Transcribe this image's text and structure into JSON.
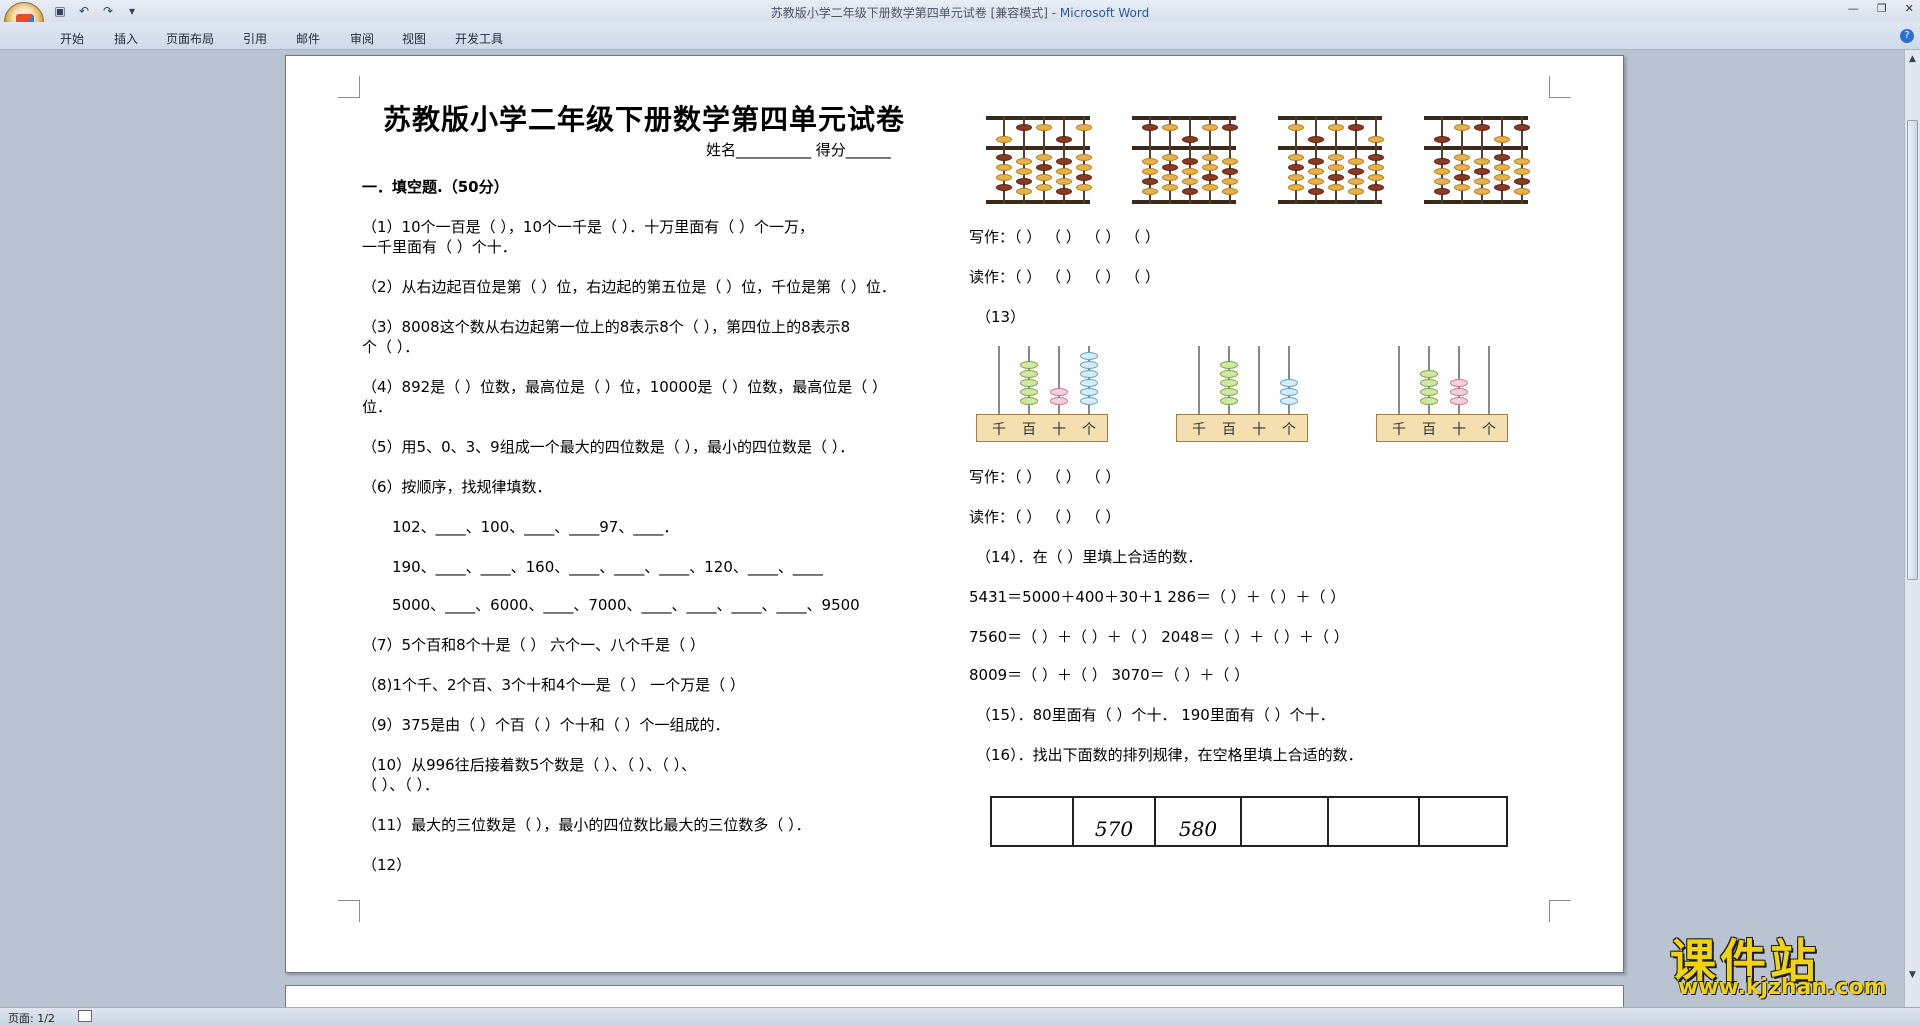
{
  "window": {
    "title_doc": "苏教版小学二年级下册数学第四单元试卷 [兼容模式] - ",
    "title_app": "Microsoft Word"
  },
  "menu": [
    "开始",
    "插入",
    "页面布局",
    "引用",
    "邮件",
    "审阅",
    "视图",
    "开发工具"
  ],
  "status": {
    "page": "页面: 1/2"
  },
  "doc": {
    "title": "苏教版小学二年级下册数学第四单元试卷",
    "name_line": "姓名__________   得分______",
    "section1": "一．填空题.（50分）",
    "q1a": "（1）10个一百是（    ），10个一千是（    ）．十万里面有（    ）个一万，",
    "q1b": "一千里面有（    ）个十．",
    "q2": "（2）从右边起百位是第（  ）位，右边起的第五位是（  ）位，千位是第（  ）位．",
    "q3a": "（3）8008这个数从右边起第一位上的8表示8个（    ），第四位上的8表示8",
    "q3b": "个（    ）．",
    "q4a": "（4）892是（  ）位数，最高位是（  ）位，10000是（  ）位数，最高位是（  ）",
    "q4b": "位．",
    "q5": "（5）用5、0、3、9组成一个最大的四位数是（    ），最小的四位数是（    ）．",
    "q6": "（6）按顺序，找规律填数．",
    "q6a": "102、____、100、____、____97、____．",
    "q6b": "190、____、____、160、____、____、____、120、____、____",
    "q6c": "5000、____、6000、____、7000、____、____、____、____、9500",
    "q7": "（7）5个百和8个十是（     ）      六个一、八个千是（          ）",
    "q8": "（8)1个千、2个百、3个十和4个一是（     ）   一个万是（            ）",
    "q9": "（9）375是由（    ）个百（     ）个十和（    ）个一组成的．",
    "q10a": "（10）从996往后接着数5个数是（        ）、（         ）、（          ）、",
    "q10b": "（          ）、（            ）．",
    "q11": "（11）最大的三位数是（    ），最小的四位数比最大的三位数多（        ）．",
    "q12": "（12）",
    "write1": "写作：（         ）            （         ）       （         ）        （         ）",
    "read1": "读作：（         ）            （         ）       （         ）        （         ）",
    "q13": "（13）",
    "write2": "写作：（         ）                 （         ）                 （         ）",
    "read2": "读作：（         ）                  （         ）                 （         ）",
    "q14": "（14）．在（      ）里填上合适的数．",
    "q14a": "5431＝5000＋400＋30＋1     286＝（    ）＋（     ）＋（     ）",
    "q14b": "7560＝（     ）＋（  ）＋（  ）      2048＝（    ）＋（  ）＋（  ）",
    "q14c": "8009＝（     ）＋（     ）            3070＝（     ）＋（    ）",
    "q15": "（15）．80里面有（    ）个十．      190里面有（        ）个十．",
    "q16": "（16）．找出下面数的排列规律，在空格里填上合适的数．",
    "table16": [
      "",
      "570",
      "580",
      "",
      "",
      ""
    ],
    "place_labels": [
      "千",
      "百",
      "十",
      "个"
    ]
  },
  "watermark": {
    "big": "课件站",
    "url": "www.kjzhan.com"
  }
}
